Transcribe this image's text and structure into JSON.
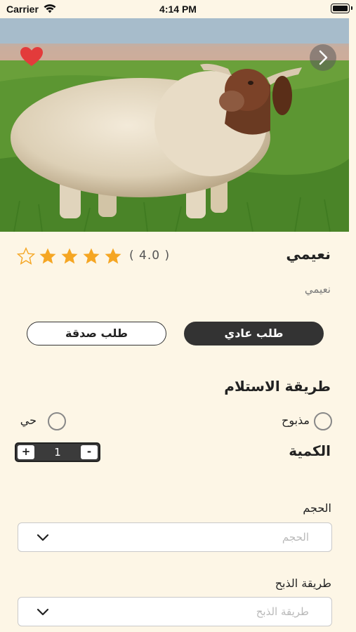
{
  "status_bar": {
    "carrier": "Carrier",
    "time": "4:14 PM"
  },
  "product": {
    "title": "نعيمي",
    "subtitle": "نعيمي",
    "rating_text": "( 4.0 )",
    "rating": 4,
    "rating_max": 5
  },
  "order_type": {
    "normal_label": "طلب عادي",
    "sadaqa_label": "طلب صدقة",
    "selected": "normal"
  },
  "delivery": {
    "title": "طريقة الاستلام",
    "options": [
      {
        "label": "مذبوح",
        "selected": false
      },
      {
        "label": "حي",
        "selected": false
      }
    ]
  },
  "quantity": {
    "label": "الكمية",
    "value": "1",
    "plus": "+",
    "minus": "-"
  },
  "size": {
    "label": "الحجم",
    "placeholder": "الحجم"
  },
  "slaughter": {
    "label": "طريقة الذبح",
    "placeholder": "طريقة الذبح"
  },
  "colors": {
    "background": "#fdf6e6",
    "dark_button": "#333333",
    "star": "#f5a623",
    "heart": "#e33b3b"
  },
  "icons": {
    "favorite": "heart-icon",
    "next": "chevron-right-icon",
    "dropdown": "chevron-down-icon",
    "star": "star-icon",
    "wifi": "wifi-icon",
    "battery": "battery-icon"
  }
}
